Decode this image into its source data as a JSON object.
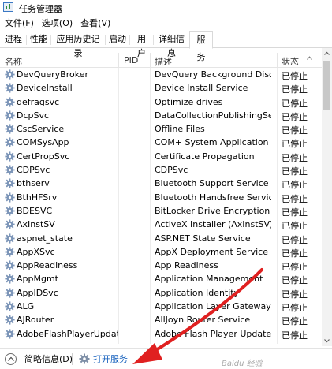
{
  "window": {
    "title": "任务管理器"
  },
  "menu": [
    "文件(F)",
    "选项(O)",
    "查看(V)"
  ],
  "tabs": [
    "进程",
    "性能",
    "应用历史记录",
    "启动",
    "用户",
    "详细信息",
    "服务"
  ],
  "active_tab": "服务",
  "columns": {
    "name": "名称",
    "pid": "PID",
    "desc": "描述",
    "status": "状态"
  },
  "rows": [
    {
      "name": "DevQueryBroker",
      "desc": "DevQuery Background Disco...",
      "status": "已停止"
    },
    {
      "name": "DeviceInstall",
      "desc": "Device Install Service",
      "status": "已停止"
    },
    {
      "name": "defragsvc",
      "desc": "Optimize drives",
      "status": "已停止"
    },
    {
      "name": "DcpSvc",
      "desc": "DataCollectionPublishingServi...",
      "status": "已停止"
    },
    {
      "name": "CscService",
      "desc": "Offline Files",
      "status": "已停止"
    },
    {
      "name": "COMSysApp",
      "desc": "COM+ System Application",
      "status": "已停止"
    },
    {
      "name": "CertPropSvc",
      "desc": "Certificate Propagation",
      "status": "已停止"
    },
    {
      "name": "CDPSvc",
      "desc": "CDPSvc",
      "status": "已停止"
    },
    {
      "name": "bthserv",
      "desc": "Bluetooth Support Service",
      "status": "已停止"
    },
    {
      "name": "BthHFSrv",
      "desc": "Bluetooth Handsfree Service",
      "status": "已停止"
    },
    {
      "name": "BDESVC",
      "desc": "BitLocker Drive Encryption Se...",
      "status": "已停止"
    },
    {
      "name": "AxInstSV",
      "desc": "ActiveX Installer (AxInstSV)",
      "status": "已停止"
    },
    {
      "name": "aspnet_state",
      "desc": "ASP.NET State Service",
      "status": "已停止"
    },
    {
      "name": "AppXSvc",
      "desc": "AppX Deployment Service (Ap...",
      "status": "已停止"
    },
    {
      "name": "AppReadiness",
      "desc": "App Readiness",
      "status": "已停止"
    },
    {
      "name": "AppMgmt",
      "desc": "Application Management",
      "status": "已停止"
    },
    {
      "name": "AppIDSvc",
      "desc": "Application Identity",
      "status": "已停止"
    },
    {
      "name": "ALG",
      "desc": "Application Layer Gateway Se...",
      "status": "已停止"
    },
    {
      "name": "AJRouter",
      "desc": "AllJoyn Router Service",
      "status": "已停止"
    },
    {
      "name": "AdobeFlashPlayerUpdat...",
      "desc": "Adobe Flash Player Update S...",
      "status": "已停止"
    }
  ],
  "bottom": {
    "fewer_details": "简略信息(D)",
    "open_services": "打开服务"
  },
  "watermark": "Baidu 经验",
  "colors": {
    "link": "#1560bd",
    "annotation_arrow": "#e02020",
    "icon_blue": "#5a86c4"
  },
  "icons": {
    "service": "gear-icon",
    "fewer_details": "chevron-up-circle-icon",
    "open_services": "gear-icon"
  }
}
